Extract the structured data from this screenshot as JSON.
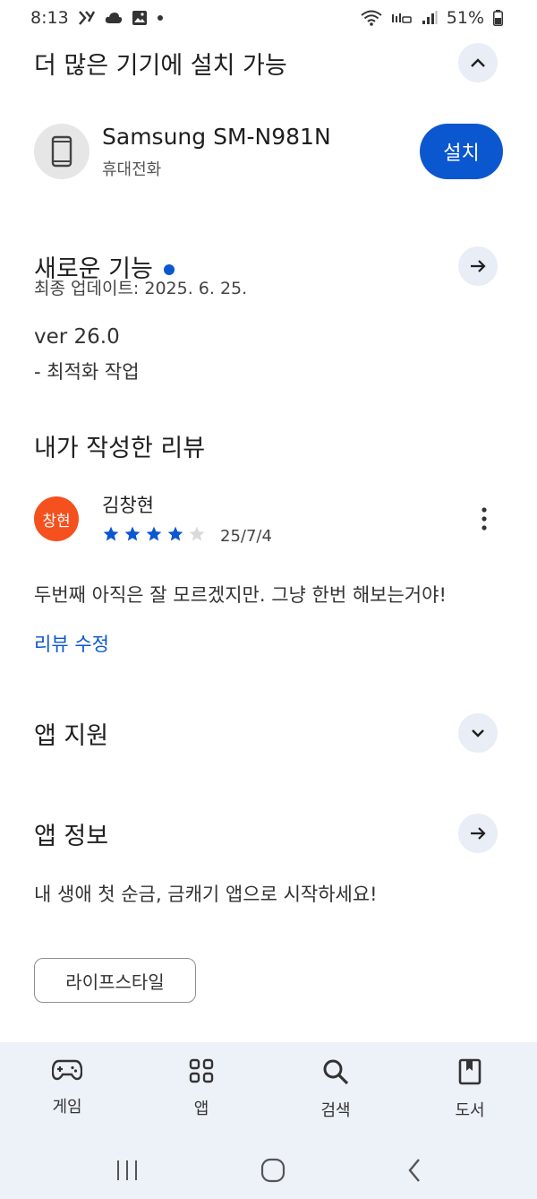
{
  "status_bar": {
    "time": "8:13",
    "battery": "51%"
  },
  "more_devices": {
    "title": "더 많은 기기에 설치 가능"
  },
  "device": {
    "name": "Samsung SM-N981N",
    "type": "휴대전화",
    "install_label": "설치"
  },
  "whats_new": {
    "title": "새로운 기능",
    "updated": "최종 업데이트: 2025. 6. 25.",
    "version": "ver 26.0",
    "notes": "- 최적화 작업"
  },
  "my_review": {
    "title": "내가 작성한 리뷰",
    "avatar_text": "창현",
    "reviewer": "김창현",
    "rating": 4,
    "rating_max": 5,
    "date": "25/7/4",
    "text": "두번째 아직은 잘 모르겠지만. 그냥 한번 해보는거야!",
    "edit_label": "리뷰 수정"
  },
  "app_support": {
    "title": "앱 지원"
  },
  "app_info": {
    "title": "앱 정보",
    "description": "내 생애 첫 순금, 금캐기 앱으로 시작하세요!",
    "category_chip": "라이프스타일"
  },
  "bottom_nav": {
    "games": "게임",
    "apps": "앱",
    "search": "검색",
    "books": "도서"
  },
  "colors": {
    "accent": "#0b57d0",
    "avatar": "#f4511e",
    "nav_bg": "#edf1f8",
    "button_bg": "#e8edf6"
  }
}
